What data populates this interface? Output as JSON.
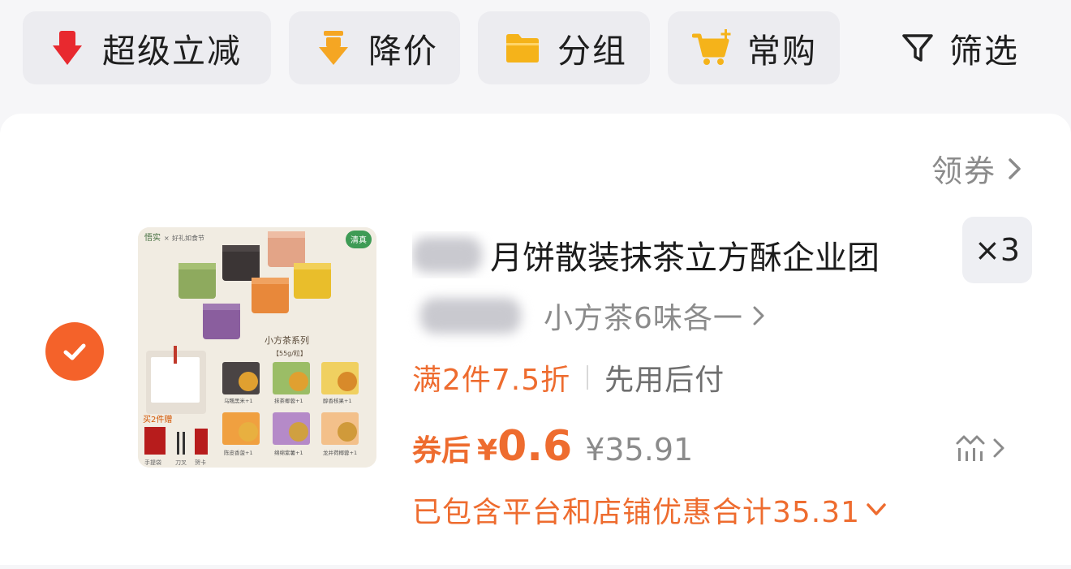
{
  "toolbar": {
    "chips": [
      {
        "label": "超级立减",
        "icon": "red-arrow-down-icon",
        "color": "#e8292f"
      },
      {
        "label": "降价",
        "icon": "yellow-arrow-down-icon",
        "color": "#f5a623"
      },
      {
        "label": "分组",
        "icon": "folder-icon",
        "color": "#f5b31a"
      },
      {
        "label": "常购",
        "icon": "cart-plus-icon",
        "color": "#f5b31a"
      }
    ],
    "filter_label": "筛选"
  },
  "card": {
    "coupon_link": "领券",
    "product": {
      "title": "月饼散装抹茶立方酥企业团",
      "quantity": "×3",
      "sku": "小方茶6味各一",
      "thumb": {
        "brand": "悟实",
        "collab": "好礼如食节",
        "badge": "清真",
        "series": "小方茶系列",
        "spec": "【55g/粒】",
        "gift": "买2件赠",
        "gift_items": [
          "手提袋",
          "刀叉",
          "贺卡"
        ],
        "flavors": [
          "乌糯黑米+1",
          "抹茶椰蓉+1",
          "醇香核果+1",
          "陈皮香菠+1",
          "绵绵紫薯+1",
          "龙井荷椰蓉+1"
        ]
      }
    },
    "promo": {
      "discount": "满2件7.5折",
      "pay_later": "先用后付"
    },
    "price": {
      "coupon_after_label": "券后",
      "currency": "¥",
      "final": "0.6",
      "original": "¥35.91"
    },
    "savings_text": "已包含平台和店铺优惠合计35.31"
  },
  "colors": {
    "accent": "#ee6c2f",
    "check_bg": "#f4622a",
    "page_bg": "#f6f6f8"
  }
}
